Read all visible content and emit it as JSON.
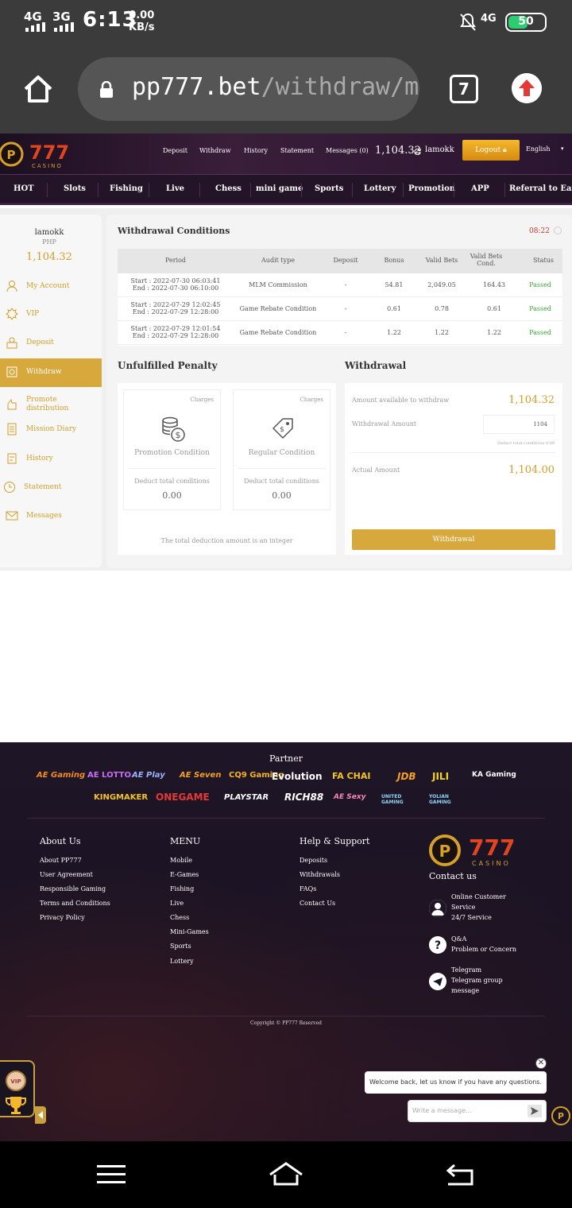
{
  "status_bar": {
    "net1": "4G",
    "net2": "3G",
    "time": "6:13",
    "speed_value": "0.00",
    "speed_unit": "KB/s",
    "net_right": "4G",
    "battery": "50"
  },
  "browser": {
    "url_host": "pp777.bet",
    "url_path": "/withdraw/ma",
    "tab_count": "7"
  },
  "header": {
    "logo_text": "777",
    "logo_sub": "CASINO",
    "links": [
      "Deposit",
      "Withdraw",
      "History",
      "Statement",
      "Messages (0)"
    ],
    "balance": "1,104.32",
    "username": "lamokk",
    "logout": "Logout",
    "language": "English"
  },
  "nav": [
    "HOT",
    "Slots",
    "Fishing",
    "Live",
    "Chess",
    "mini game",
    "Sports",
    "Lottery",
    "Promotion",
    "APP",
    "Referral to Earn"
  ],
  "sidebar": {
    "username": "lamokk",
    "currency": "PHP",
    "balance": "1,104.32",
    "items": [
      "My Account",
      "VIP",
      "Deposit",
      "Withdraw",
      "Promote distribution",
      "Mission Diary",
      "History",
      "Statement",
      "Messages"
    ],
    "active": "Withdraw"
  },
  "withdrawal_conditions": {
    "title": "Withdrawal Conditions",
    "timer": "08:22",
    "headers": [
      "Period",
      "Audit type",
      "Deposit",
      "Bonus",
      "Valid Bets",
      "Valid Bets Cond.",
      "Status"
    ],
    "rows": [
      {
        "start": "Start : 2022-07-30 06:03:41",
        "end": "End : 2022-07-30 06:10:00",
        "audit": "MLM Commission",
        "deposit": "-",
        "bonus": "54.81",
        "valid_bets": "2,049.05",
        "cond": "164.43",
        "status": "Passed"
      },
      {
        "start": "Start : 2022-07-29 12:02:45",
        "end": "End : 2022-07-29 12:28:00",
        "audit": "Game Rebate Condition",
        "deposit": "-",
        "bonus": "0.61",
        "valid_bets": "0.78",
        "cond": "0.61",
        "status": "Passed"
      },
      {
        "start": "Start : 2022-07-29 12:01:54",
        "end": "End : 2022-07-29 12:28:00",
        "audit": "Game Rebate Condition",
        "deposit": "-",
        "bonus": "1.22",
        "valid_bets": "1.22",
        "cond": "1.22",
        "status": "Passed"
      }
    ]
  },
  "penalty": {
    "title": "Unfulfilled Penalty",
    "cards": [
      {
        "charges": "Charges",
        "name": "Promotion Condition",
        "deduct": "Deduct total conditions",
        "value": "0.00"
      },
      {
        "charges": "Charges",
        "name": "Regular Condition",
        "deduct": "Deduct total conditions",
        "value": "0.00"
      }
    ],
    "note": "The total deduction amount is an integer"
  },
  "withdrawal": {
    "title": "Withdrawal",
    "available_label": "Amount available to withdraw",
    "available": "1,104.32",
    "amount_label": "Withdrawal Amount",
    "amount_value": "1104",
    "deduct_note": "Deduct total conditions 0.00",
    "actual_label": "Actual Amount",
    "actual": "1,104.00",
    "button": "Withdrawal"
  },
  "footer": {
    "partner_title": "Partner",
    "partners_row1": [
      "AE Gaming",
      "AE LOTTO",
      "AE Play",
      "AE Seven",
      "CQ9 Gaming",
      "Evolution",
      "FA CHAI",
      "JDB",
      "JILI",
      "KA Gaming"
    ],
    "partners_row2": [
      "KINGMAKER",
      "ONEGAME",
      "PLAYSTAR",
      "RICH88",
      "AE Sexy",
      "UNITED GAMING",
      "YOLIAN GAMING"
    ],
    "about_title": "About Us",
    "about": [
      "About PP777",
      "User Agreement",
      "Responsible Gaming",
      "Terms and Conditions",
      "Privacy Policy"
    ],
    "menu_title": "MENU",
    "menu": [
      "Mobile",
      "E-Games",
      "Fishing",
      "Live",
      "Chess",
      "Mini-Games",
      "Sports",
      "Lottery"
    ],
    "help_title": "Help & Support",
    "help": [
      "Deposits",
      "Withdrawals",
      "FAQs",
      "Contact Us"
    ],
    "contact_title": "Contact us",
    "contacts": [
      {
        "l1": "Online Customer",
        "l2": "Service",
        "l3": "24/7 Service"
      },
      {
        "l1": "Q&A",
        "l2": "Problem or Concern",
        "l3": ""
      },
      {
        "l1": "Telegram",
        "l2": "Telegram group",
        "l3": "message"
      }
    ],
    "copyright": "Copyright © PP777 Reserved"
  },
  "float": {
    "vip": "VIP"
  },
  "chat": {
    "welcome": "Welcome back, let us know if you have any questions.",
    "placeholder": "Write a message..."
  },
  "colors": {
    "gold": "#d7a83c",
    "passed": "#3aa63a",
    "timer": "#c0392b"
  }
}
